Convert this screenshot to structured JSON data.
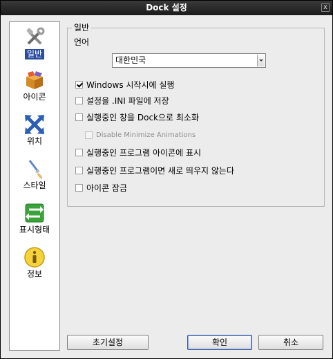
{
  "window": {
    "title": "Dock 설정",
    "close_glyph": "x"
  },
  "sidebar": {
    "items": [
      {
        "label": "일반",
        "icon": "tools-icon",
        "selected": true
      },
      {
        "label": "아이콘",
        "icon": "box-icon",
        "selected": false
      },
      {
        "label": "위치",
        "icon": "arrows-icon",
        "selected": false
      },
      {
        "label": "스타일",
        "icon": "brush-icon",
        "selected": false
      },
      {
        "label": "표시형태",
        "icon": "swap-arrows-icon",
        "selected": false
      },
      {
        "label": "정보",
        "icon": "info-icon",
        "selected": false
      }
    ]
  },
  "general": {
    "group_title": "일반",
    "language_label": "언어",
    "language_value": "대한민국",
    "options": [
      {
        "label": "Windows 시작시에 실행",
        "checked": true,
        "enabled": true
      },
      {
        "label": "설정을 .INI 파일에 저장",
        "checked": false,
        "enabled": true
      },
      {
        "label": "실행중인 창을 Dock으로 최소화",
        "checked": false,
        "enabled": true
      },
      {
        "label": "Disable Minimize Animations",
        "checked": false,
        "enabled": false
      },
      {
        "label": "실행중인 프로그램 아이콘에 표시",
        "checked": false,
        "enabled": true
      },
      {
        "label": "실행중인 프로그램이면 새로 띄우지 않는다",
        "checked": false,
        "enabled": true
      },
      {
        "label": "아이콘 잠금",
        "checked": false,
        "enabled": true
      }
    ]
  },
  "buttons": {
    "reset": "초기설정",
    "ok": "확인",
    "cancel": "취소"
  },
  "colors": {
    "selection": "#2b4ea0",
    "titlebar": "#1b1b1b",
    "dialog_bg": "#ececec"
  }
}
